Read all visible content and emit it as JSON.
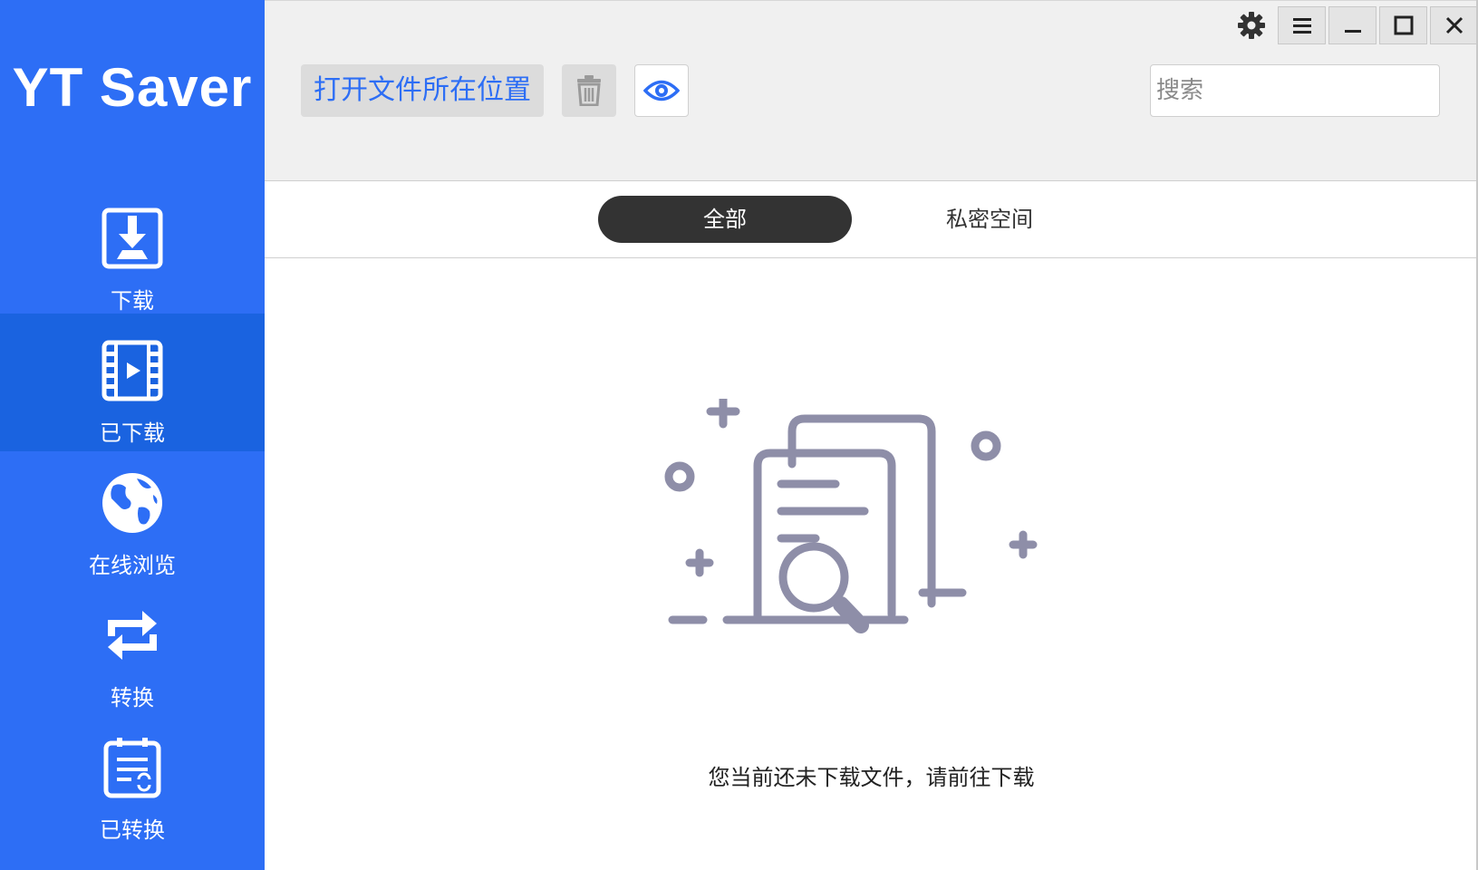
{
  "app": {
    "brand": "YT Saver",
    "accent_color": "#2d6ef5",
    "active_nav_color": "#1a63e0"
  },
  "sidebar": {
    "items": [
      {
        "label": "下载",
        "icon": "download-icon",
        "active": false
      },
      {
        "label": "已下载",
        "icon": "film-icon",
        "active": true
      },
      {
        "label": "在线浏览",
        "icon": "globe-icon",
        "active": false
      },
      {
        "label": "转换",
        "icon": "convert-icon",
        "active": false
      },
      {
        "label": "已转换",
        "icon": "converted-list-icon",
        "active": false
      }
    ]
  },
  "toolbar": {
    "open_folder_label": "打开文件所在位置",
    "trash_icon": "trash-icon",
    "eye_icon": "eye-icon",
    "search_placeholder": "搜索"
  },
  "window_controls": [
    "gear-icon",
    "menu-icon",
    "minimize-icon",
    "maximize-icon",
    "close-icon"
  ],
  "tabs": [
    {
      "label": "全部",
      "active": true
    },
    {
      "label": "私密空间",
      "active": false
    }
  ],
  "empty_state": {
    "message": "您当前还未下载文件，请前往下载",
    "icon": "empty-document-search-icon"
  }
}
